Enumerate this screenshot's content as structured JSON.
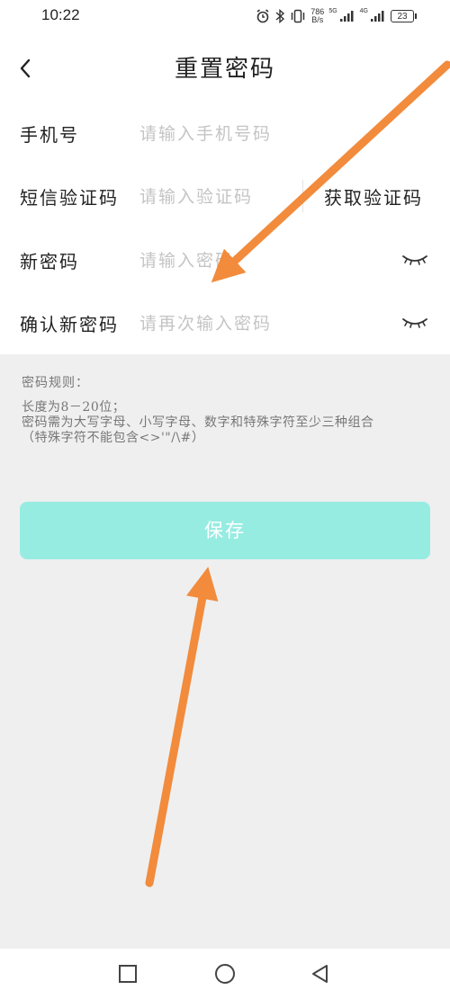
{
  "status_bar": {
    "time": "10:22",
    "net_speed_value": "786",
    "net_speed_unit": "B/s",
    "net1_label": "5G",
    "net2_label": "4G",
    "battery": "23",
    "icons": [
      "alarm-icon",
      "bluetooth-icon",
      "vibrate-icon",
      "signal-icon",
      "battery-icon"
    ]
  },
  "header": {
    "title": "重置密码",
    "back_icon": "chevron-left-icon"
  },
  "form": {
    "phone": {
      "label": "手机号",
      "placeholder": "请输入手机号码",
      "value": ""
    },
    "sms_code": {
      "label": "短信验证码",
      "placeholder": "请输入验证码",
      "value": "",
      "get_code_label": "获取验证码"
    },
    "new_password": {
      "label": "新密码",
      "placeholder": "请输入密码",
      "value": ""
    },
    "confirm_password": {
      "label": "确认新密码",
      "placeholder": "请再次输入密码",
      "value": ""
    }
  },
  "rules": {
    "title": "密码规则：",
    "lines": [
      "长度为8－20位；",
      "密码需为大写字母、小写字母、数字和特殊字符至少三种组合",
      "（特殊字符不能包含<>'\"/\\#）"
    ]
  },
  "save_button": {
    "label": "保存"
  },
  "colors": {
    "accent": "#97ece2",
    "annotation_arrow": "#f28b3c",
    "placeholder": "#c4c4c4"
  },
  "nav_bar": {
    "icons": [
      "recent-apps-icon",
      "home-icon",
      "back-icon"
    ]
  }
}
